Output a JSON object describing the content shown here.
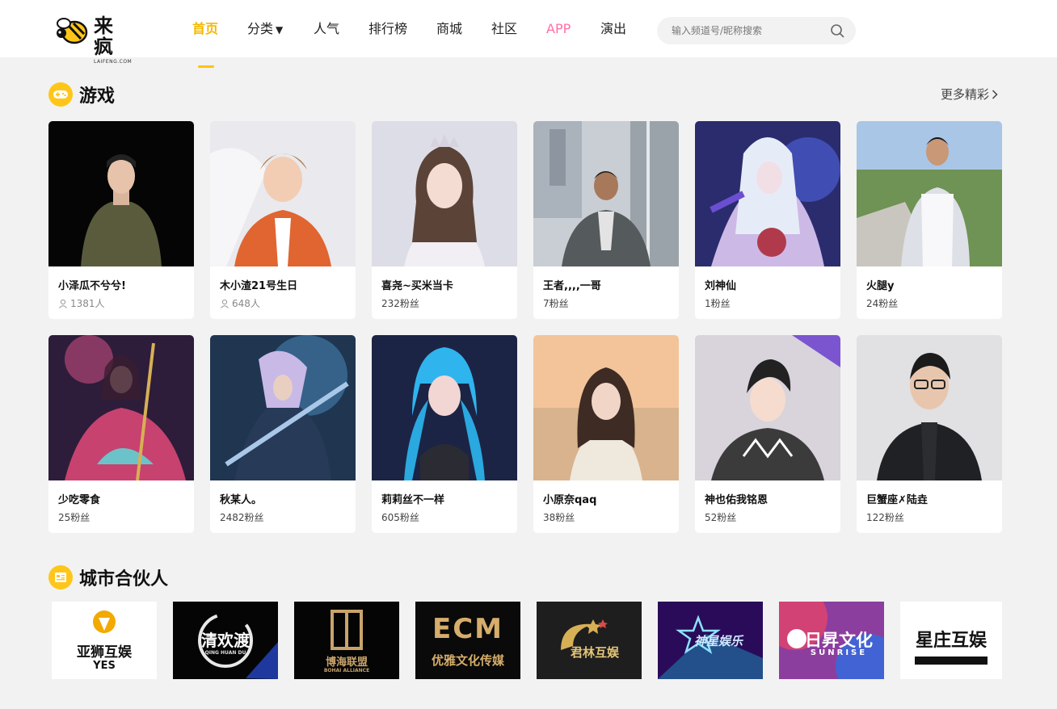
{
  "logo": {
    "name": "来疯",
    "domain": "LAIFENG.COM"
  },
  "nav": [
    {
      "label": "首页",
      "active": true
    },
    {
      "label": "分类",
      "dropdown": true
    },
    {
      "label": "人气"
    },
    {
      "label": "排行榜"
    },
    {
      "label": "商城"
    },
    {
      "label": "社区"
    },
    {
      "label": "APP"
    },
    {
      "label": "演出"
    }
  ],
  "search": {
    "placeholder": "输入频道号/昵称搜索",
    "value": ""
  },
  "games_section": {
    "title": "游戏",
    "more": "更多精彩"
  },
  "cards": [
    {
      "name": "小泽瓜不兮兮!",
      "meta": "1381人",
      "meta_type": "viewers"
    },
    {
      "name": "木小渣21号生日",
      "meta": "648人",
      "meta_type": "viewers"
    },
    {
      "name": "喜尧~买米当卡",
      "meta": "232粉丝",
      "meta_type": "fans"
    },
    {
      "name": "王者,,,,一哥",
      "meta": "7粉丝",
      "meta_type": "fans"
    },
    {
      "name": "刘神仙",
      "meta": "1粉丝",
      "meta_type": "fans"
    },
    {
      "name": "火腿y",
      "meta": "24粉丝",
      "meta_type": "fans"
    },
    {
      "name": "少吃零食",
      "meta": "25粉丝",
      "meta_type": "fans"
    },
    {
      "name": "秋某人。",
      "meta": "2482粉丝",
      "meta_type": "fans"
    },
    {
      "name": "莉莉丝不一样",
      "meta": "605粉丝",
      "meta_type": "fans"
    },
    {
      "name": "小原奈qaq",
      "meta": "38粉丝",
      "meta_type": "fans"
    },
    {
      "name": "神也佑我铭恩",
      "meta": "52粉丝",
      "meta_type": "fans"
    },
    {
      "name": "巨蟹座✗陆垚",
      "meta": "122粉丝",
      "meta_type": "fans"
    }
  ],
  "partners_section": {
    "title": "城市合伙人"
  },
  "partners": [
    {
      "name": "亚狮互娱",
      "sub": "YES"
    },
    {
      "name": "清欢渡",
      "sub": "QING HUAN DU"
    },
    {
      "name": "博海联盟",
      "sub": "BOHAI ALLIANCE"
    },
    {
      "name": "优雅文化传媒",
      "sub": "ECM"
    },
    {
      "name": "君林互娱",
      "sub": ""
    },
    {
      "name": "神星娱乐",
      "sub": ""
    },
    {
      "name": "日昇文化",
      "sub": "SUNRISE"
    },
    {
      "name": "星庄互娱",
      "sub": ""
    }
  ],
  "colors": {
    "accent": "#ffc400",
    "app_pink": "#ff6fa4",
    "page_bg": "#f2f2f2"
  }
}
